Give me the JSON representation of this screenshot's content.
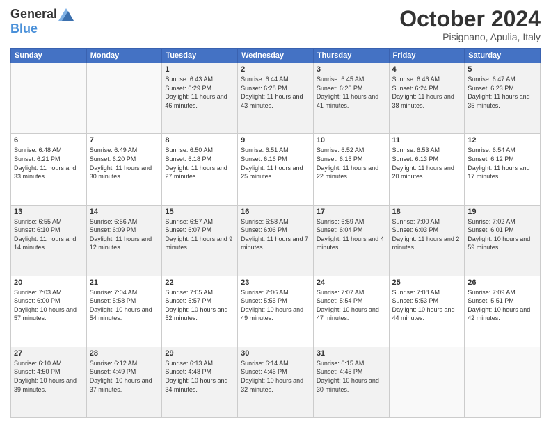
{
  "header": {
    "logo_general": "General",
    "logo_blue": "Blue",
    "month_title": "October 2024",
    "location": "Pisignano, Apulia, Italy"
  },
  "days_of_week": [
    "Sunday",
    "Monday",
    "Tuesday",
    "Wednesday",
    "Thursday",
    "Friday",
    "Saturday"
  ],
  "weeks": [
    [
      {
        "day": "",
        "info": ""
      },
      {
        "day": "",
        "info": ""
      },
      {
        "day": "1",
        "info": "Sunrise: 6:43 AM\nSunset: 6:29 PM\nDaylight: 11 hours and 46 minutes."
      },
      {
        "day": "2",
        "info": "Sunrise: 6:44 AM\nSunset: 6:28 PM\nDaylight: 11 hours and 43 minutes."
      },
      {
        "day": "3",
        "info": "Sunrise: 6:45 AM\nSunset: 6:26 PM\nDaylight: 11 hours and 41 minutes."
      },
      {
        "day": "4",
        "info": "Sunrise: 6:46 AM\nSunset: 6:24 PM\nDaylight: 11 hours and 38 minutes."
      },
      {
        "day": "5",
        "info": "Sunrise: 6:47 AM\nSunset: 6:23 PM\nDaylight: 11 hours and 35 minutes."
      }
    ],
    [
      {
        "day": "6",
        "info": "Sunrise: 6:48 AM\nSunset: 6:21 PM\nDaylight: 11 hours and 33 minutes."
      },
      {
        "day": "7",
        "info": "Sunrise: 6:49 AM\nSunset: 6:20 PM\nDaylight: 11 hours and 30 minutes."
      },
      {
        "day": "8",
        "info": "Sunrise: 6:50 AM\nSunset: 6:18 PM\nDaylight: 11 hours and 27 minutes."
      },
      {
        "day": "9",
        "info": "Sunrise: 6:51 AM\nSunset: 6:16 PM\nDaylight: 11 hours and 25 minutes."
      },
      {
        "day": "10",
        "info": "Sunrise: 6:52 AM\nSunset: 6:15 PM\nDaylight: 11 hours and 22 minutes."
      },
      {
        "day": "11",
        "info": "Sunrise: 6:53 AM\nSunset: 6:13 PM\nDaylight: 11 hours and 20 minutes."
      },
      {
        "day": "12",
        "info": "Sunrise: 6:54 AM\nSunset: 6:12 PM\nDaylight: 11 hours and 17 minutes."
      }
    ],
    [
      {
        "day": "13",
        "info": "Sunrise: 6:55 AM\nSunset: 6:10 PM\nDaylight: 11 hours and 14 minutes."
      },
      {
        "day": "14",
        "info": "Sunrise: 6:56 AM\nSunset: 6:09 PM\nDaylight: 11 hours and 12 minutes."
      },
      {
        "day": "15",
        "info": "Sunrise: 6:57 AM\nSunset: 6:07 PM\nDaylight: 11 hours and 9 minutes."
      },
      {
        "day": "16",
        "info": "Sunrise: 6:58 AM\nSunset: 6:06 PM\nDaylight: 11 hours and 7 minutes."
      },
      {
        "day": "17",
        "info": "Sunrise: 6:59 AM\nSunset: 6:04 PM\nDaylight: 11 hours and 4 minutes."
      },
      {
        "day": "18",
        "info": "Sunrise: 7:00 AM\nSunset: 6:03 PM\nDaylight: 11 hours and 2 minutes."
      },
      {
        "day": "19",
        "info": "Sunrise: 7:02 AM\nSunset: 6:01 PM\nDaylight: 10 hours and 59 minutes."
      }
    ],
    [
      {
        "day": "20",
        "info": "Sunrise: 7:03 AM\nSunset: 6:00 PM\nDaylight: 10 hours and 57 minutes."
      },
      {
        "day": "21",
        "info": "Sunrise: 7:04 AM\nSunset: 5:58 PM\nDaylight: 10 hours and 54 minutes."
      },
      {
        "day": "22",
        "info": "Sunrise: 7:05 AM\nSunset: 5:57 PM\nDaylight: 10 hours and 52 minutes."
      },
      {
        "day": "23",
        "info": "Sunrise: 7:06 AM\nSunset: 5:55 PM\nDaylight: 10 hours and 49 minutes."
      },
      {
        "day": "24",
        "info": "Sunrise: 7:07 AM\nSunset: 5:54 PM\nDaylight: 10 hours and 47 minutes."
      },
      {
        "day": "25",
        "info": "Sunrise: 7:08 AM\nSunset: 5:53 PM\nDaylight: 10 hours and 44 minutes."
      },
      {
        "day": "26",
        "info": "Sunrise: 7:09 AM\nSunset: 5:51 PM\nDaylight: 10 hours and 42 minutes."
      }
    ],
    [
      {
        "day": "27",
        "info": "Sunrise: 6:10 AM\nSunset: 4:50 PM\nDaylight: 10 hours and 39 minutes."
      },
      {
        "day": "28",
        "info": "Sunrise: 6:12 AM\nSunset: 4:49 PM\nDaylight: 10 hours and 37 minutes."
      },
      {
        "day": "29",
        "info": "Sunrise: 6:13 AM\nSunset: 4:48 PM\nDaylight: 10 hours and 34 minutes."
      },
      {
        "day": "30",
        "info": "Sunrise: 6:14 AM\nSunset: 4:46 PM\nDaylight: 10 hours and 32 minutes."
      },
      {
        "day": "31",
        "info": "Sunrise: 6:15 AM\nSunset: 4:45 PM\nDaylight: 10 hours and 30 minutes."
      },
      {
        "day": "",
        "info": ""
      },
      {
        "day": "",
        "info": ""
      }
    ]
  ]
}
